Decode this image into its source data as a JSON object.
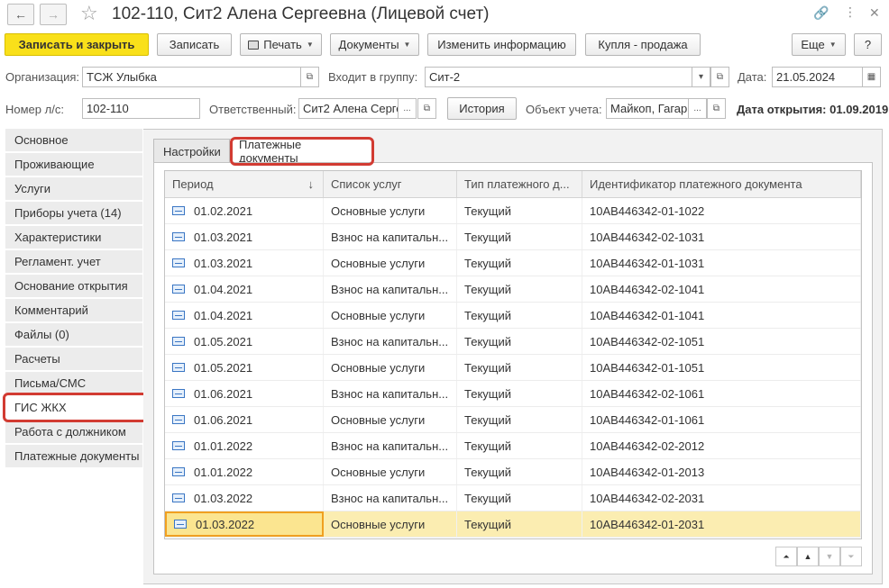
{
  "window": {
    "title": "102-110, Сит2 Алена Сергеевна (Лицевой счет)",
    "back_icon": "←",
    "forward_icon": "→",
    "star_icon": "☆",
    "link_icon": "🔗",
    "more_icon": "⋮",
    "close_icon": "✕"
  },
  "toolbar": {
    "save_close": "Записать и закрыть",
    "save": "Записать",
    "print": "Печать",
    "documents": "Документы",
    "change_info": "Изменить информацию",
    "buy_sell": "Купля - продажа",
    "more": "Еще",
    "help": "?"
  },
  "form": {
    "org_label": "Организация:",
    "org_value": "ТСЖ Улыбка",
    "group_label": "Входит в группу:",
    "group_value": "Сит-2",
    "date_label": "Дата:",
    "date_value": "21.05.2024",
    "account_label": "Номер л/с:",
    "account_value": "102-110",
    "responsible_label": "Ответственный:",
    "responsible_value": "Сит2 Алена Серге",
    "history": "История",
    "object_label": "Объект учета:",
    "object_value": "Майкоп, Гагар",
    "opening_date": "Дата открытия: 01.09.2019",
    "dots": "...",
    "open_glyph": "⧉",
    "dropdown_glyph": "▾",
    "calendar_glyph": "▦"
  },
  "nav": {
    "items": [
      "Основное",
      "Проживающие",
      "Услуги",
      "Приборы учета (14)",
      "Характеристики",
      "Регламент. учет",
      "Основание открытия",
      "Комментарий",
      "Файлы (0)",
      "Расчеты",
      "Письма/СМС",
      "ГИС ЖКХ",
      "Работа с должником",
      "Платежные документы"
    ]
  },
  "tabs": {
    "settings": "Настройки",
    "payment_docs": "Платежные документы"
  },
  "table": {
    "headers": [
      "Период",
      "Список услуг",
      "Тип платежного д...",
      "Идентификатор платежного документа"
    ],
    "sort_icon": "↓",
    "rows": [
      [
        "01.02.2021",
        "Основные услуги",
        "Текущий",
        "10AB446342-01-1022"
      ],
      [
        "01.03.2021",
        "Взнос на капитальн...",
        "Текущий",
        "10AB446342-02-1031"
      ],
      [
        "01.03.2021",
        "Основные услуги",
        "Текущий",
        "10AB446342-01-1031"
      ],
      [
        "01.04.2021",
        "Взнос на капитальн...",
        "Текущий",
        "10AB446342-02-1041"
      ],
      [
        "01.04.2021",
        "Основные услуги",
        "Текущий",
        "10AB446342-01-1041"
      ],
      [
        "01.05.2021",
        "Взнос на капитальн...",
        "Текущий",
        "10AB446342-02-1051"
      ],
      [
        "01.05.2021",
        "Основные услуги",
        "Текущий",
        "10AB446342-01-1051"
      ],
      [
        "01.06.2021",
        "Взнос на капитальн...",
        "Текущий",
        "10AB446342-02-1061"
      ],
      [
        "01.06.2021",
        "Основные услуги",
        "Текущий",
        "10AB446342-01-1061"
      ],
      [
        "01.01.2022",
        "Взнос на капитальн...",
        "Текущий",
        "10AB446342-02-2012"
      ],
      [
        "01.01.2022",
        "Основные услуги",
        "Текущий",
        "10AB446342-01-2013"
      ],
      [
        "01.03.2022",
        "Взнос на капитальн...",
        "Текущий",
        "10AB446342-02-2031"
      ],
      [
        "01.03.2022",
        "Основные услуги",
        "Текущий",
        "10AB446342-01-2031"
      ]
    ]
  },
  "pager": {
    "first": "⏶",
    "up": "▲",
    "down": "▼",
    "last": "⏷"
  }
}
